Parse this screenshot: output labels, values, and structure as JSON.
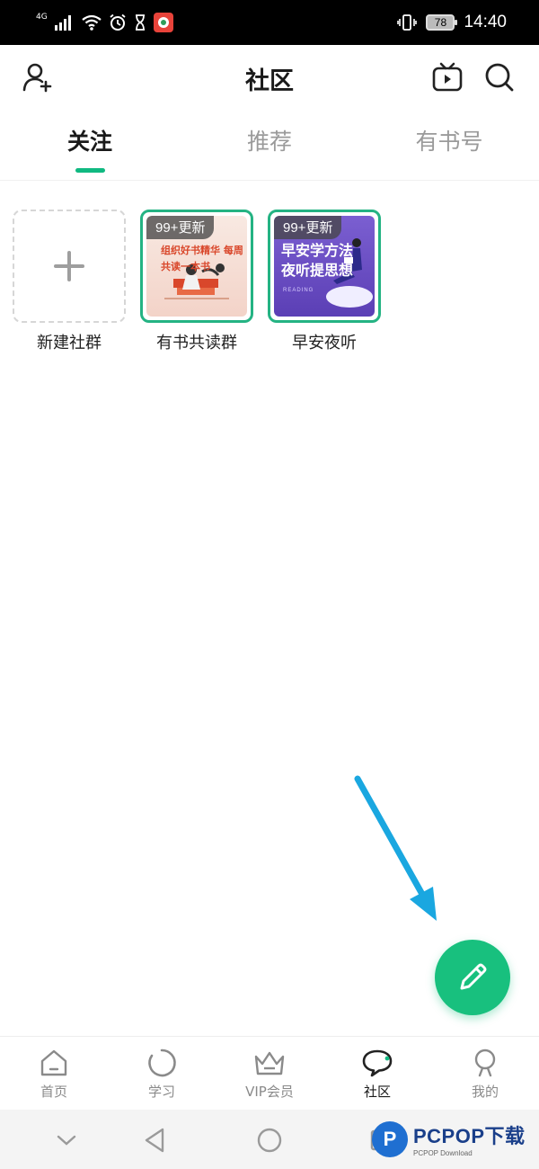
{
  "status_bar": {
    "network": "4G",
    "battery": "78",
    "time": "14:40"
  },
  "header": {
    "title": "社区"
  },
  "tabs": [
    {
      "label": "关注",
      "active": true
    },
    {
      "label": "推荐",
      "active": false
    },
    {
      "label": "有书号",
      "active": false
    }
  ],
  "groups": {
    "new_group_label": "新建社群",
    "items": [
      {
        "label": "有书共读群",
        "badge": "99+更新",
        "cover_text": "组织好书精华 每周共读一本书"
      },
      {
        "label": "早安夜听",
        "badge": "99+更新",
        "cover_text_1": "早安学方法",
        "cover_text_2": "夜听提思想",
        "cover_caption": "READING"
      }
    ]
  },
  "bottom_nav": [
    {
      "label": "首页",
      "icon": "home-icon",
      "active": false
    },
    {
      "label": "学习",
      "icon": "study-icon",
      "active": false
    },
    {
      "label": "VIP会员",
      "icon": "crown-icon",
      "active": false
    },
    {
      "label": "社区",
      "icon": "chat-bubble-icon",
      "active": true
    },
    {
      "label": "我的",
      "icon": "profile-icon",
      "active": false
    }
  ],
  "watermark": {
    "main": "PCPOP下载",
    "sub": "PCPOP Download"
  },
  "colors": {
    "accent": "#10b981",
    "fab": "#18c07e",
    "arrow": "#1aa7e0",
    "tile_border": "#24b383"
  }
}
